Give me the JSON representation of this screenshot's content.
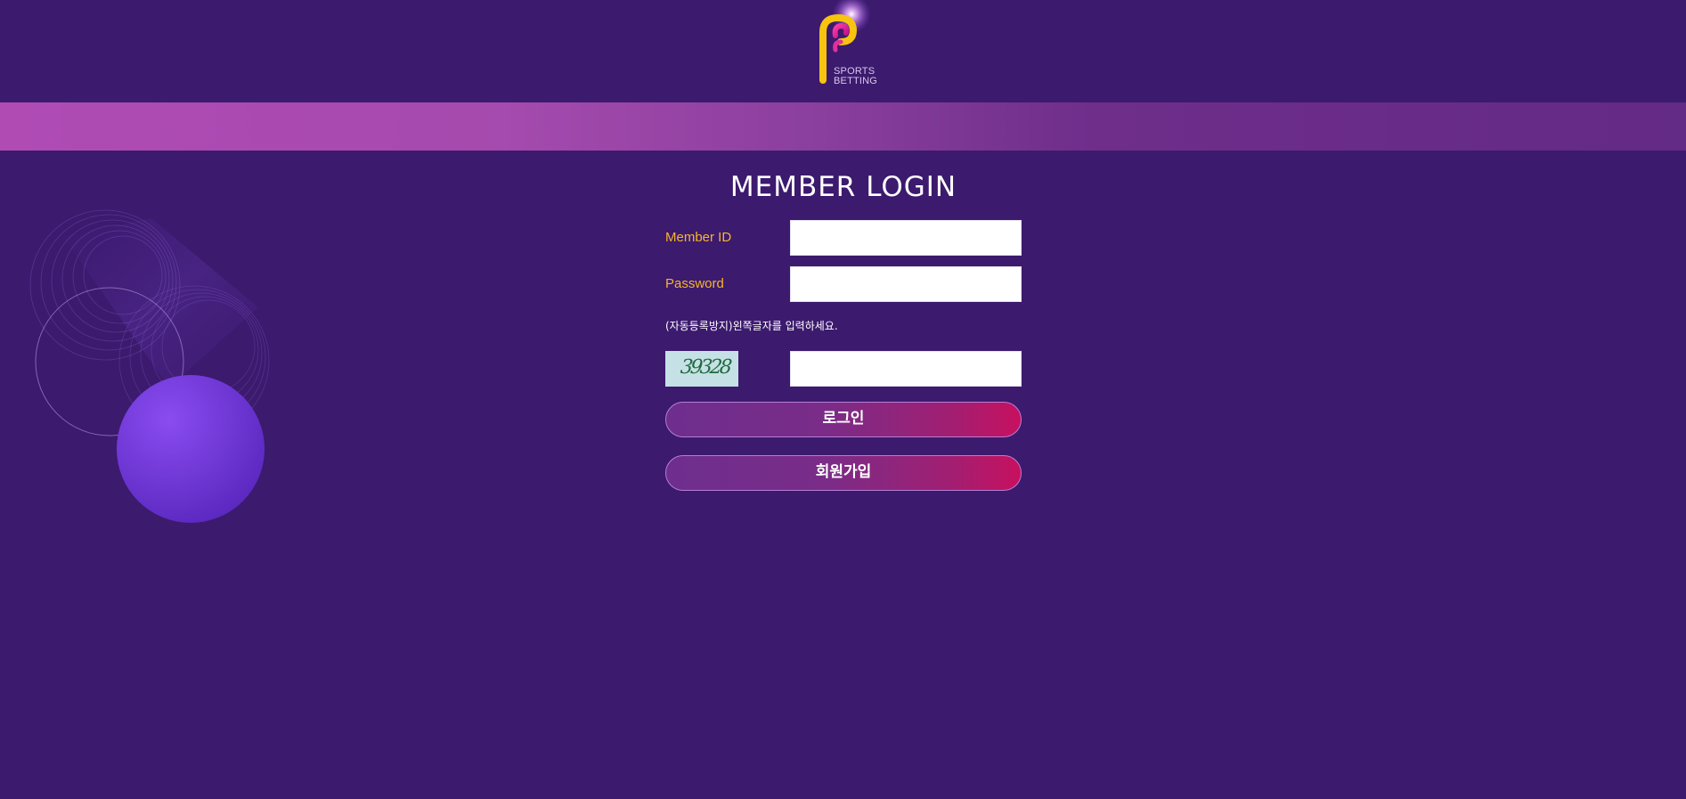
{
  "header": {
    "logo_line1": "SPORTS",
    "logo_line2": "BETTING",
    "logo_icon": "sports-betting-logo-icon"
  },
  "login": {
    "title": "MEMBER LOGIN",
    "member_id_label": "Member ID",
    "password_label": "Password",
    "member_id_value": "",
    "password_value": "",
    "captcha_notice": "(자동등록방지)왼쪽글자를 입력하세요.",
    "captcha_code": "39328",
    "captcha_value": "",
    "login_button": "로그인",
    "join_button": "회원가입"
  },
  "colors": {
    "background": "#3c1a6e",
    "label": "#f5b52e",
    "button_start": "#6e2e8e",
    "button_end": "#c8105f"
  }
}
